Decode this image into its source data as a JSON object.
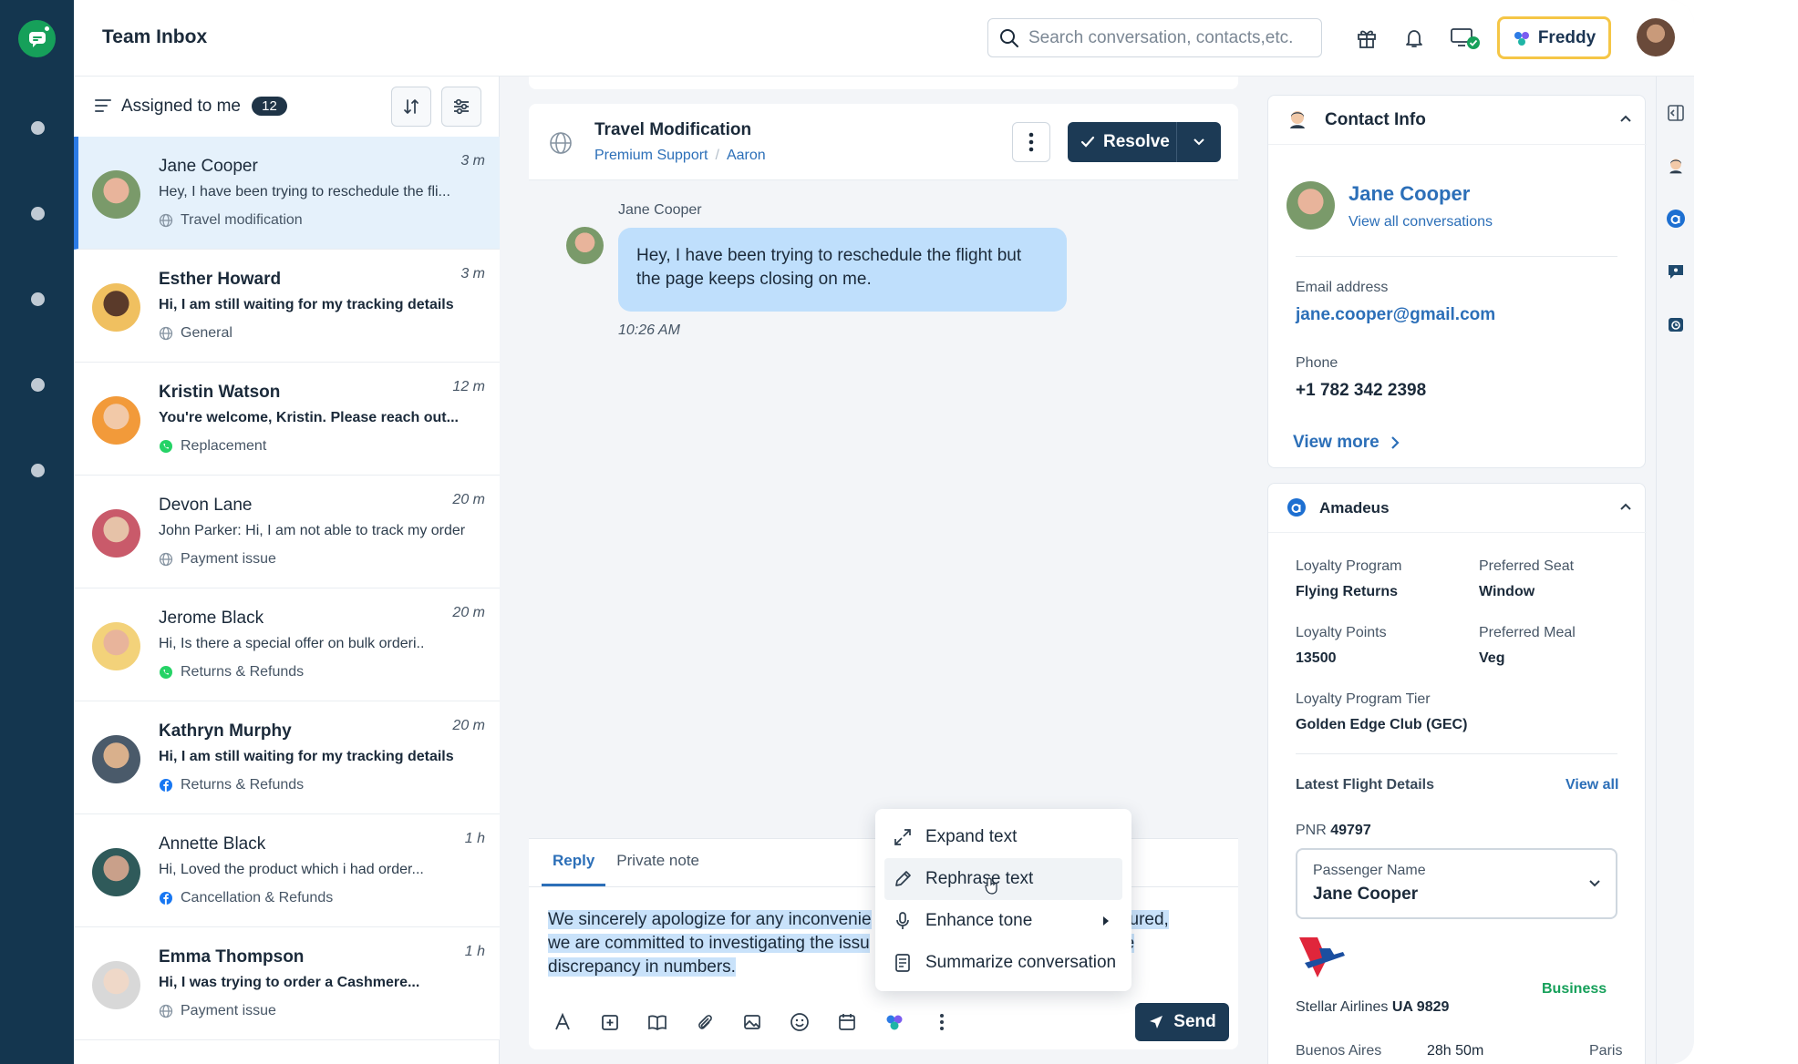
{
  "header": {
    "title": "Team Inbox",
    "search_placeholder": "Search conversation, contacts,etc.",
    "freddy_label": "Freddy"
  },
  "list": {
    "filter_label": "Assigned to me",
    "count": "12",
    "conversations": [
      {
        "name": "Jane Cooper",
        "time": "3 m",
        "preview": "Hey, I have been trying to reschedule the fli...",
        "tag": "Travel modification",
        "channel": "web",
        "unread": false
      },
      {
        "name": "Esther Howard",
        "time": "3 m",
        "preview": "Hi, I am still waiting for my tracking details",
        "tag": "General",
        "channel": "web",
        "unread": true
      },
      {
        "name": "Kristin Watson",
        "time": "12 m",
        "preview": "You're welcome, Kristin. Please reach out...",
        "tag": "Replacement",
        "channel": "whatsapp",
        "unread": true
      },
      {
        "name": "Devon Lane",
        "time": "20 m",
        "preview": "John Parker: Hi, I am not able to track my order",
        "tag": "Payment issue",
        "channel": "web",
        "unread": false
      },
      {
        "name": "Jerome Black",
        "time": "20 m",
        "preview": "Hi, Is there a special offer on bulk orderi..",
        "tag": "Returns & Refunds",
        "channel": "whatsapp",
        "unread": false
      },
      {
        "name": "Kathryn Murphy",
        "time": "20 m",
        "preview": "Hi, I am still waiting for my tracking details",
        "tag": "Returns & Refunds",
        "channel": "facebook",
        "unread": true
      },
      {
        "name": "Annette Black",
        "time": "1 h",
        "preview": "Hi, Loved the product which i had order...",
        "tag": "Cancellation & Refunds",
        "channel": "facebook",
        "unread": false
      },
      {
        "name": "Emma Thompson",
        "time": "1 h",
        "preview": "Hi, I was trying to order a Cashmere...",
        "tag": "Payment issue",
        "channel": "web",
        "unread": true
      }
    ]
  },
  "conversation": {
    "title": "Travel Modification",
    "group": "Premium Support",
    "agent": "Aaron",
    "resolve_label": "Resolve",
    "message": {
      "sender": "Jane Cooper",
      "text": "Hey, I have been trying to reschedule the flight but the page keeps closing on me.",
      "time": "10:26 AM"
    }
  },
  "composer": {
    "tab_reply": "Reply",
    "tab_note": "Private note",
    "line1": "We sincerely apologize for any inconvenie",
    "line1_end": "ssured,",
    "line2": "we are committed to investigating the issu",
    "line2_end": "the",
    "line3": "discrepancy in numbers.",
    "send_label": "Send"
  },
  "ai_menu": {
    "items": [
      "Expand text",
      "Rephrase text",
      "Enhance tone",
      "Summarize conversation"
    ]
  },
  "contact": {
    "section_title": "Contact Info",
    "name": "Jane Cooper",
    "view_all": "View all conversations",
    "email_label": "Email address",
    "email": "jane.cooper@gmail.com",
    "phone_label": "Phone",
    "phone": "+1 782 342 2398",
    "view_more": "View more"
  },
  "amadeus": {
    "section_title": "Amadeus",
    "loyalty_program_label": "Loyalty Program",
    "loyalty_program": "Flying Returns",
    "preferred_seat_label": "Preferred Seat",
    "preferred_seat": "Window",
    "loyalty_points_label": "Loyalty Points",
    "loyalty_points": "13500",
    "preferred_meal_label": "Preferred Meal",
    "preferred_meal": "Veg",
    "tier_label": "Loyalty Program Tier",
    "tier": "Golden Edge Club (GEC)",
    "latest_label": "Latest Flight Details",
    "view_all": "View all",
    "pnr_label": "PNR",
    "pnr": "49797",
    "passenger_label": "Passenger Name",
    "passenger": "Jane Cooper",
    "class": "Business",
    "airline": "Stellar Airlines",
    "flight": "UA 9829",
    "from": "Buenos Aires",
    "duration": "28h 50m",
    "to": "Paris"
  },
  "colors": {
    "rail": "#14364f",
    "accent": "#2c6fb8",
    "primary_button": "#1c3a55",
    "bubble": "#bfdffc",
    "active_row": "#e5f1fb",
    "freddy_border": "#f5c646",
    "whatsapp": "#25d366",
    "facebook": "#1877f2"
  }
}
